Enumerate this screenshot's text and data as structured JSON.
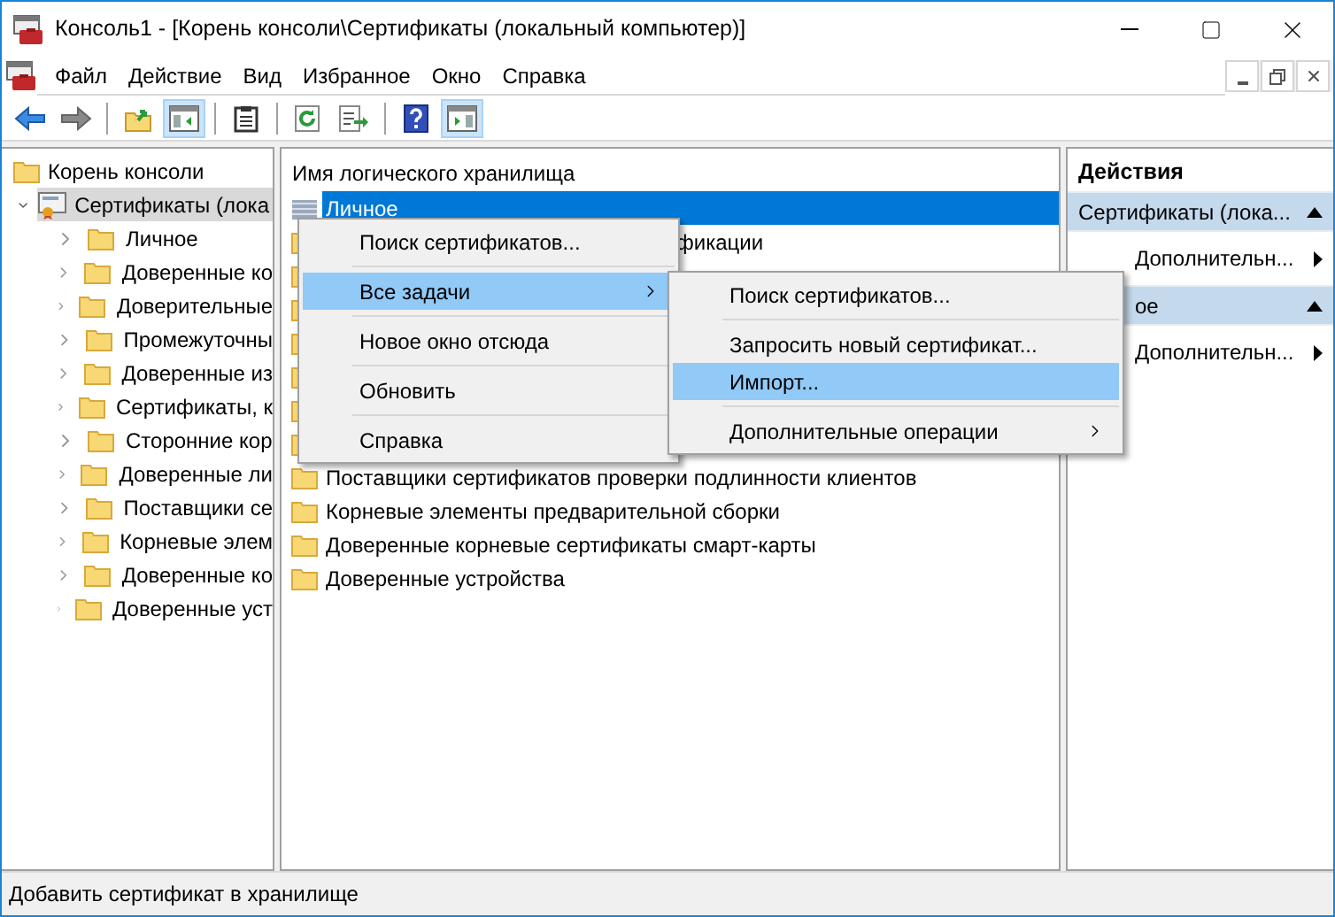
{
  "window": {
    "title": "Консоль1 - [Корень консоли\\Сертификаты (локальный компьютер)]"
  },
  "menu_bar": [
    "Файл",
    "Действие",
    "Вид",
    "Избранное",
    "Окно",
    "Справка"
  ],
  "toolbar": [
    {
      "kind": "back",
      "pressed": false
    },
    {
      "kind": "forward",
      "pressed": false
    },
    {
      "kind": "sep"
    },
    {
      "kind": "up",
      "pressed": false
    },
    {
      "kind": "tree",
      "pressed": true
    },
    {
      "kind": "sep"
    },
    {
      "kind": "clipboard",
      "pressed": false
    },
    {
      "kind": "sep"
    },
    {
      "kind": "refresh",
      "pressed": false
    },
    {
      "kind": "export",
      "pressed": false
    },
    {
      "kind": "sep"
    },
    {
      "kind": "help",
      "pressed": false
    },
    {
      "kind": "actions",
      "pressed": true
    }
  ],
  "tree": {
    "label": "Корень консоли",
    "children": [
      {
        "label": "Сертификаты (лока",
        "selected": true,
        "expanded": true,
        "children": [
          {
            "label": "Личное"
          },
          {
            "label": "Доверенные ко"
          },
          {
            "label": "Доверительные"
          },
          {
            "label": "Промежуточны"
          },
          {
            "label": "Доверенные из"
          },
          {
            "label": "Сертификаты, к"
          },
          {
            "label": "Сторонние кор"
          },
          {
            "label": "Доверенные ли"
          },
          {
            "label": "Поставщики се"
          },
          {
            "label": "Корневые элем"
          },
          {
            "label": "Доверенные ко"
          },
          {
            "label": "Доверенные уст"
          }
        ]
      }
    ]
  },
  "list": {
    "column": "Имя логического хранилища",
    "rows": [
      {
        "kind": "full",
        "label": "Личное",
        "selected": true
      },
      {
        "kind": "partial",
        "label": "фикации",
        "selected": false
      },
      {
        "kind": "covered"
      },
      {
        "kind": "covered"
      },
      {
        "kind": "covered"
      },
      {
        "kind": "covered"
      },
      {
        "kind": "covered"
      },
      {
        "kind": "covered"
      },
      {
        "kind": "full",
        "label": "Поставщики сертификатов проверки подлинности клиентов",
        "selected": false
      },
      {
        "kind": "full",
        "label": "Корневые элементы предварительной сборки",
        "selected": false
      },
      {
        "kind": "full",
        "label": "Доверенные корневые сертификаты смарт-карты",
        "selected": false
      },
      {
        "kind": "full",
        "label": "Доверенные устройства",
        "selected": false
      }
    ]
  },
  "actions": {
    "title": "Действия",
    "sections": [
      {
        "title": "Сертификаты (лока...",
        "items": [
          "Дополнительн..."
        ]
      },
      {
        "title": "ое",
        "items": [
          "Дополнительн..."
        ]
      }
    ]
  },
  "context_menu": [
    {
      "kind": "item",
      "label": "Поиск сертификатов...",
      "selected": false,
      "submenu": false
    },
    {
      "kind": "separator"
    },
    {
      "kind": "item",
      "label": "Все задачи",
      "selected": true,
      "submenu": true
    },
    {
      "kind": "separator"
    },
    {
      "kind": "item",
      "label": "Новое окно отсюда",
      "selected": false,
      "submenu": false
    },
    {
      "kind": "separator"
    },
    {
      "kind": "item",
      "label": "Обновить",
      "selected": false,
      "submenu": false
    },
    {
      "kind": "separator"
    },
    {
      "kind": "item",
      "label": "Справка",
      "selected": false,
      "submenu": false
    }
  ],
  "submenu": [
    {
      "kind": "item",
      "label": "Поиск сертификатов...",
      "selected": false,
      "submenu": false
    },
    {
      "kind": "separator"
    },
    {
      "kind": "item",
      "label": "Запросить новый сертификат...",
      "selected": false,
      "submenu": false
    },
    {
      "kind": "item",
      "label": "Импорт...",
      "selected": true,
      "submenu": false
    },
    {
      "kind": "separator"
    },
    {
      "kind": "item",
      "label": "Дополнительные операции",
      "selected": false,
      "submenu": true
    }
  ],
  "status_bar": "Добавить сертификат в хранилище"
}
